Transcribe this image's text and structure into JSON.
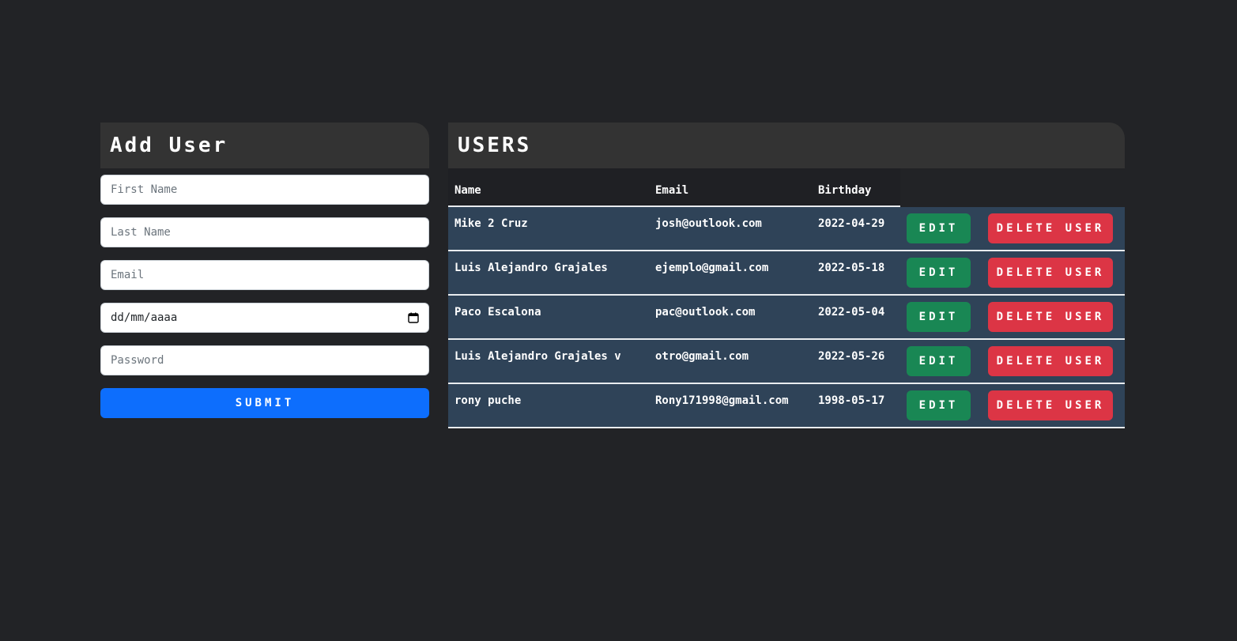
{
  "add_user": {
    "title": "Add User",
    "first_name_placeholder": "First Name",
    "last_name_placeholder": "Last Name",
    "email_placeholder": "Email",
    "birthday_placeholder": "dd/mm/aaaa",
    "password_placeholder": "Password",
    "submit_label": "SUBMIT"
  },
  "users": {
    "title": "USERS",
    "columns": [
      "Name",
      "Email",
      "Birthday"
    ],
    "edit_label": "EDIT",
    "delete_label": "DELETE USER",
    "rows": [
      {
        "name": "Mike 2 Cruz",
        "email": "josh@outlook.com",
        "birthday": "2022-04-29"
      },
      {
        "name": "Luis Alejandro Grajales",
        "email": "ejemplo@gmail.com",
        "birthday": "2022-05-18"
      },
      {
        "name": "Paco Escalona",
        "email": "pac@outlook.com",
        "birthday": "2022-05-04"
      },
      {
        "name": "Luis Alejandro Grajales v",
        "email": "otro@gmail.com",
        "birthday": "2022-05-26"
      },
      {
        "name": "rony puche",
        "email": "Rony171998@gmail.com",
        "birthday": "1998-05-17"
      }
    ]
  },
  "colors": {
    "background": "#222326",
    "header": "#333333",
    "row": "#2f4358",
    "primary": "#0d6efd",
    "success": "#198754",
    "danger": "#dc3545"
  },
  "icons": {
    "date_picker": "calendar-icon"
  }
}
